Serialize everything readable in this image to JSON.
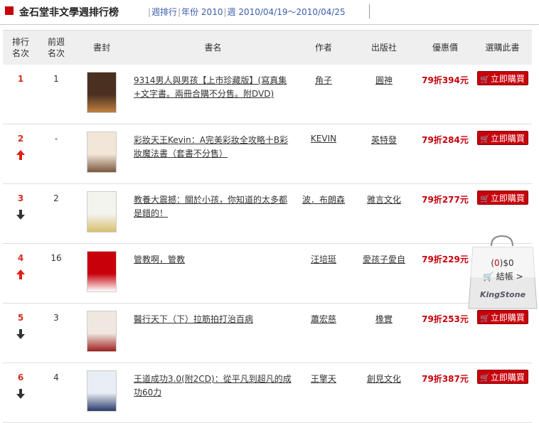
{
  "header": {
    "title": "金石堂非文學週排行榜",
    "links": [
      "週排行",
      "年份 2010",
      "週 2010/04/19～2010/04/25"
    ]
  },
  "columns": [
    "排行名次",
    "前週名次",
    "書封",
    "書名",
    "作者",
    "出版社",
    "優惠價",
    "選購此書"
  ],
  "column_lines": {
    "rank": [
      "排行",
      "名次"
    ],
    "prev": [
      "前週",
      "名次"
    ]
  },
  "rows": [
    {
      "rank": "1",
      "prev": "1",
      "trend": "",
      "title": "9314男人與男孩【上市珍藏版】(寫真集+文字書。兩冊合購不分售。附DVD)",
      "author": "角子",
      "publisher": "圓神",
      "discount": "79折",
      "price": "394元",
      "buy": "立即購買"
    },
    {
      "rank": "2",
      "prev": "-",
      "trend": "up",
      "title": "彩妝天王Kevin：A完美彩妝全攻略十B彩妝魔法書（套書不分售）",
      "author": "KEVIN",
      "publisher": "英特發",
      "discount": "79折",
      "price": "284元",
      "buy": "立即購買"
    },
    {
      "rank": "3",
      "prev": "2",
      "trend": "down",
      "title": "教養大震撼：關於小孩，你知道的太多都是錯的！",
      "author": "波．布朗森",
      "publisher": "雅言文化",
      "discount": "79折",
      "price": "277元",
      "buy": "立即購買"
    },
    {
      "rank": "4",
      "prev": "16",
      "trend": "up",
      "title": "管教啊，管教",
      "author": "汪培珽",
      "publisher": "愛孩子愛自",
      "discount": "79折",
      "price": "229元",
      "buy": "立即購買"
    },
    {
      "rank": "5",
      "prev": "3",
      "trend": "down",
      "title": "醫行天下（下）拉筋拍打治百病",
      "author": "蕭宏慈",
      "publisher": "橡實",
      "discount": "79折",
      "price": "253元",
      "buy": "立即購買"
    },
    {
      "rank": "6",
      "prev": "4",
      "trend": "down",
      "title": "王道成功3.0(附2CD)：從平凡到超凡的成功60力",
      "author": "王擎天",
      "publisher": "創見文化",
      "discount": "79折",
      "price": "387元",
      "buy": "立即購買"
    }
  ],
  "cart": {
    "count": "0",
    "amount": "$0",
    "checkout": "結帳 >",
    "brand": "KingStone"
  },
  "colors": {
    "accent": "#c8000a",
    "rank": "#d52e1e",
    "link": "#3a5da8",
    "header_bg": "#efefef"
  }
}
